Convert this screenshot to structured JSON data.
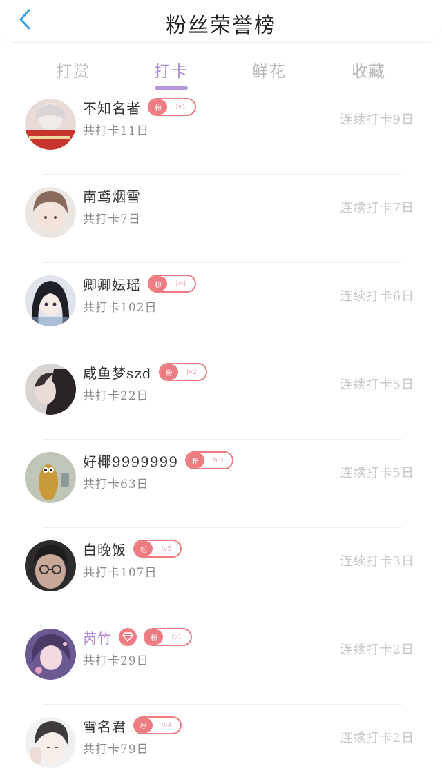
{
  "header": {
    "title": "粉丝荣誉榜",
    "back_icon": "chevron-left-icon",
    "accent_color": "#3aa0e8"
  },
  "tabs": [
    {
      "label": "打赏"
    },
    {
      "label": "打卡",
      "active": true
    },
    {
      "label": "鲜花"
    },
    {
      "label": "收藏"
    }
  ],
  "fan_badge_label": "粉",
  "colors": {
    "tab_active": "#a98bd6",
    "badge": "#ec7c82",
    "vip_name": "#b08ad6",
    "muted_text": "#c6c6c6"
  },
  "list": [
    {
      "name": "不知名者",
      "level": "lv1",
      "total": "共打卡11日",
      "streak": "连续打卡9日"
    },
    {
      "name": "南鸢烟雪",
      "total": "共打卡7日",
      "streak": "连续打卡7日"
    },
    {
      "name": "卿卿妘瑶",
      "level": "lv4",
      "total": "共打卡102日",
      "streak": "连续打卡6日"
    },
    {
      "name": "咸鱼梦szd",
      "level": "lv2",
      "total": "共打卡22日",
      "streak": "连续打卡5日"
    },
    {
      "name": "好椰9999999",
      "level": "lv3",
      "total": "共打卡63日",
      "streak": "连续打卡5日"
    },
    {
      "name": "白晚饭",
      "level": "lv5",
      "total": "共打卡107日",
      "streak": "连续打卡3日"
    },
    {
      "name": "芮竹",
      "level": "lv1",
      "vip": true,
      "total": "共打卡29日",
      "streak": "连续打卡2日"
    },
    {
      "name": "雪名君",
      "level": "lv4",
      "total": "共打卡79日",
      "streak": "连续打卡2日"
    }
  ]
}
